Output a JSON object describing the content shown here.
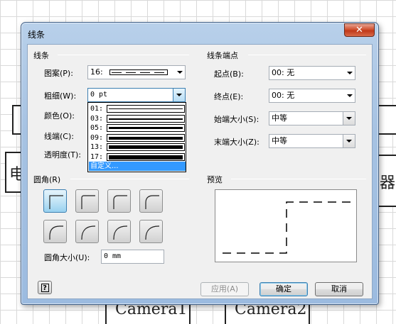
{
  "background": {
    "left_char": "电",
    "right_chars": "器",
    "camera1": "Camera1",
    "camera2": "Camera2"
  },
  "dialog": {
    "title": "线条",
    "close_glyph": "✕",
    "line_group": {
      "title": "线条",
      "pattern_label": "图案(P):",
      "pattern_value": "16:",
      "weight_label": "粗细(W):",
      "weight_value": "0 pt",
      "color_label": "颜色(O):",
      "cap_label": "线端(C):",
      "transparency_label": "透明度(T):"
    },
    "weight_dropdown": {
      "items": [
        {
          "label": "01:",
          "thickness": 1
        },
        {
          "label": "03:",
          "thickness": 2
        },
        {
          "label": "05:",
          "thickness": 3
        },
        {
          "label": "09:",
          "thickness": 4
        },
        {
          "label": "13:",
          "thickness": 5
        },
        {
          "label": "17:",
          "thickness": 6
        }
      ],
      "custom_label": "自定义..."
    },
    "endpoints_group": {
      "title": "线条端点",
      "begin_label": "起点(B):",
      "begin_value": "00: 无",
      "end_label": "终点(E):",
      "end_value": "00: 无",
      "begin_size_label": "始端大小(S):",
      "begin_size_value": "中等",
      "end_size_label": "末端大小(Z):",
      "end_size_value": "中等"
    },
    "rounding_group": {
      "title": "圆角(R)",
      "size_label": "圆角大小(U):",
      "size_value": "0 mm",
      "selected_index": 0
    },
    "preview_group": {
      "title": "预览"
    },
    "buttons": {
      "help": "?",
      "apply": "应用(A)",
      "ok": "确定",
      "cancel": "取消"
    }
  },
  "colors": {
    "selection": "#3399ff",
    "title_bar": "#a6c2e2",
    "close_button": "#c0391a"
  }
}
